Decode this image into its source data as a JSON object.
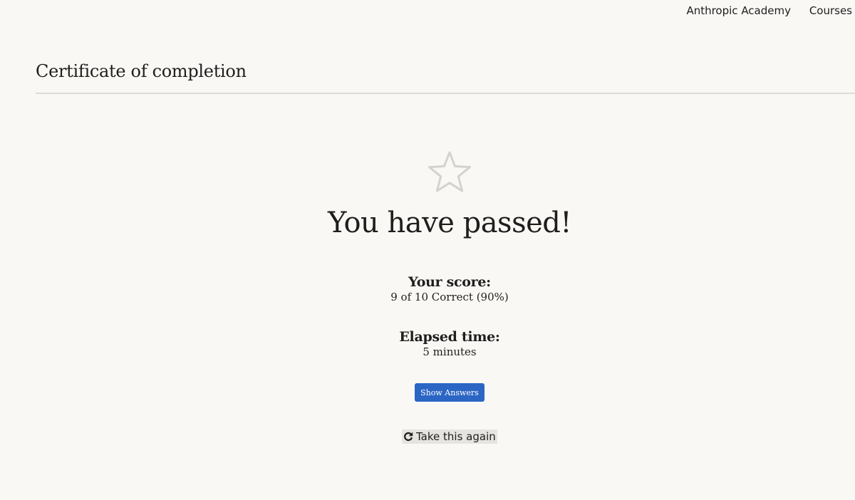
{
  "nav": {
    "academy_label": "Anthropic Academy",
    "courses_label": "Courses"
  },
  "page": {
    "title": "Certificate of completion"
  },
  "result": {
    "icon": "star-outline-icon",
    "headline": "You have passed!",
    "score_label": "Your score:",
    "score_value": "9 of 10 Correct (90%)",
    "time_label": "Elapsed time:",
    "time_value": "5 minutes",
    "show_answers_label": "Show Answers",
    "retake_label": "Take this again",
    "retake_icon": "refresh-icon"
  },
  "colors": {
    "background": "#f9f8f5",
    "text": "#1f1e1d",
    "accent_button": "#2c66c4",
    "star_outline": "#d4d2ce",
    "retake_highlight": "#e6e4df"
  }
}
